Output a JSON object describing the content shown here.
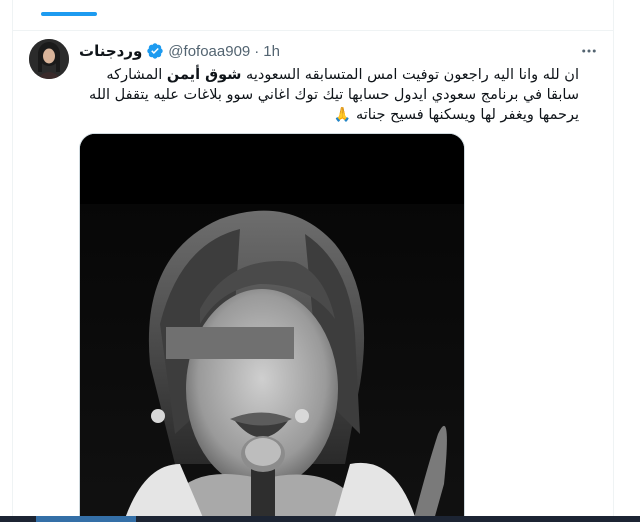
{
  "tweet": {
    "display_name": "وردجنات",
    "handle": "@fofoaa909",
    "separator": "·",
    "time": "1h",
    "text_before": "ان لله وانا اليه راجعون توفيت امس المتسابقه السعوديه ",
    "mention": "شوق أيمن",
    "text_after": " المشاركه سابقا في برنامج سعودي ايدول حسابها تيك توك اغاني سوو بلاغات عليه يتقفل الله يرحمها ويغفر لها ويسكنها فسيح جناته ",
    "emoji": "🙏"
  },
  "icons": {
    "verified": "verified-badge-icon",
    "more": "more-options-icon"
  },
  "colors": {
    "accent": "#1d9bf0",
    "text": "#0f1419",
    "secondary": "#536471",
    "border": "#eff3f4"
  }
}
